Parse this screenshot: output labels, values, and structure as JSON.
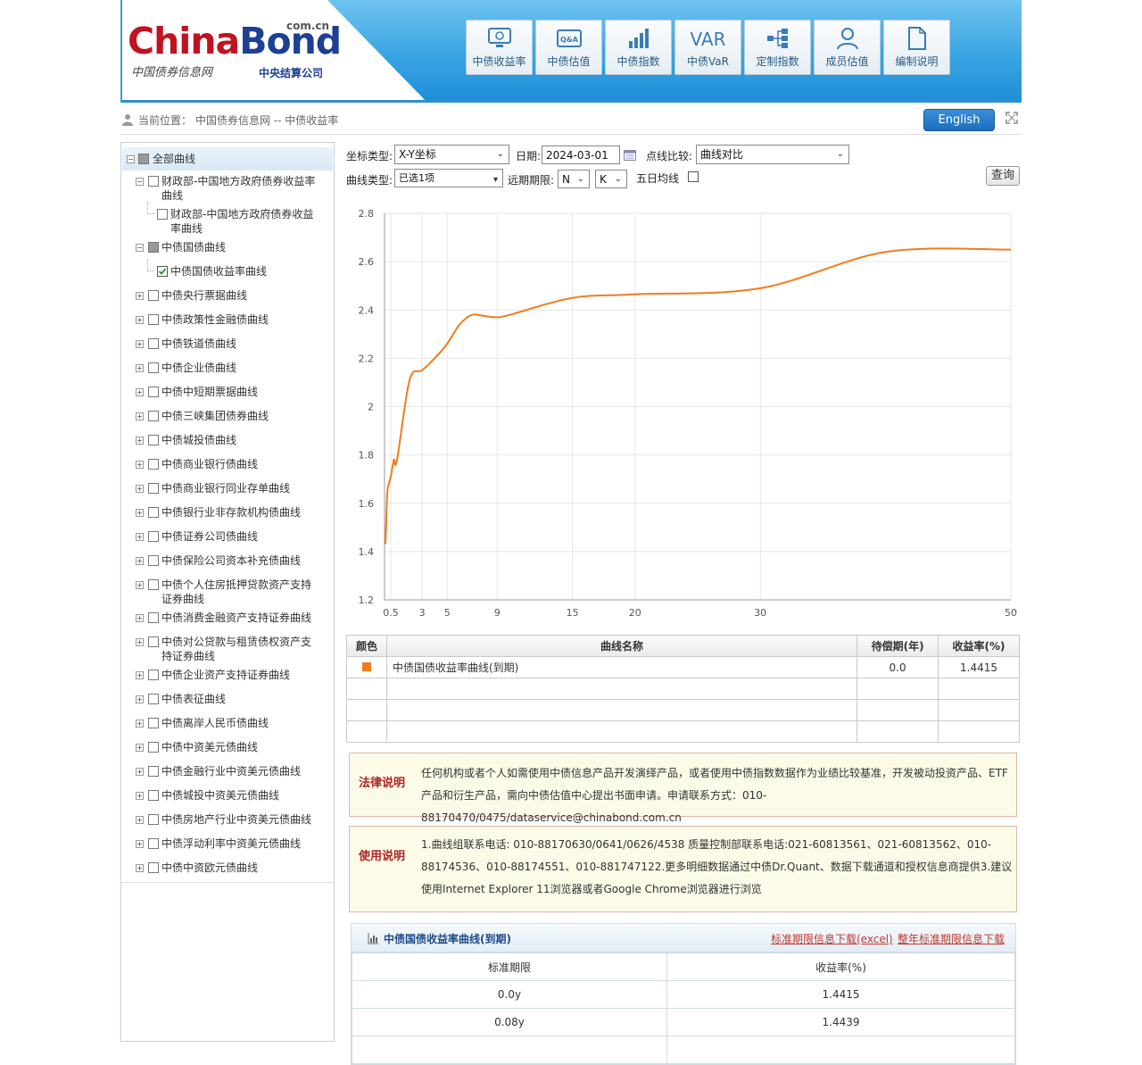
{
  "header": {
    "logo_main_a": "China",
    "logo_main_b": "Bond",
    "logo_domain": "com.cn",
    "logo_sub_left": "中国债券信息网",
    "logo_sub_right": "中央结算公司",
    "nav": [
      {
        "label": "中债收益率",
        "icon": "monitor-icon"
      },
      {
        "label": "中债估值",
        "icon": "qa-icon"
      },
      {
        "label": "中债指数",
        "icon": "bar-chart-icon"
      },
      {
        "label": "中债VaR",
        "icon": "var-icon",
        "icon_text": "VAR"
      },
      {
        "label": "定制指数",
        "icon": "tree-icon"
      },
      {
        "label": "成员估值",
        "icon": "user-icon"
      },
      {
        "label": "编制说明",
        "icon": "document-icon"
      }
    ]
  },
  "breadcrumb": {
    "prefix": "当前位置：",
    "path": "中国债券信息网 -- 中债收益率",
    "english_button": "English"
  },
  "sidebar": {
    "root_label": "全部曲线",
    "items": [
      {
        "label": "财政部-中国地方政府债券收益率曲线",
        "state": "minus"
      },
      {
        "label": "财政部-中国地方政府债券收益率曲线",
        "state": "child"
      },
      {
        "label": "中债国债曲线",
        "state": "minus"
      },
      {
        "label": "中债国债收益率曲线",
        "state": "child-checked"
      },
      {
        "label": "中债央行票据曲线",
        "state": "plus"
      },
      {
        "label": "中债政策性金融债曲线",
        "state": "plus"
      },
      {
        "label": "中债铁道债曲线",
        "state": "plus"
      },
      {
        "label": "中债企业债曲线",
        "state": "plus"
      },
      {
        "label": "中债中短期票据曲线",
        "state": "plus"
      },
      {
        "label": "中债三峡集团债券曲线",
        "state": "plus"
      },
      {
        "label": "中债城投债曲线",
        "state": "plus"
      },
      {
        "label": "中债商业银行债曲线",
        "state": "plus"
      },
      {
        "label": "中债商业银行同业存单曲线",
        "state": "plus"
      },
      {
        "label": "中债银行业非存款机构债曲线",
        "state": "plus"
      },
      {
        "label": "中债证券公司债曲线",
        "state": "plus"
      },
      {
        "label": "中债保险公司资本补充债曲线",
        "state": "plus"
      },
      {
        "label": "中债个人住房抵押贷款资产支持证券曲线",
        "state": "plus"
      },
      {
        "label": "中债消费金融资产支持证券曲线",
        "state": "plus"
      },
      {
        "label": "中债对公贷款与租赁债权资产支持证券曲线",
        "state": "plus"
      },
      {
        "label": "中债企业资产支持证券曲线",
        "state": "plus"
      },
      {
        "label": "中债表征曲线",
        "state": "plus"
      },
      {
        "label": "中债离岸人民币债曲线",
        "state": "plus"
      },
      {
        "label": "中债中资美元债曲线",
        "state": "plus"
      },
      {
        "label": "中债金融行业中资美元债曲线",
        "state": "plus"
      },
      {
        "label": "中债城投中资美元债曲线",
        "state": "plus"
      },
      {
        "label": "中债房地产行业中资美元债曲线",
        "state": "plus"
      },
      {
        "label": "中债浮动利率中资美元债曲线",
        "state": "plus"
      },
      {
        "label": "中债中资欧元债曲线",
        "state": "plus"
      }
    ]
  },
  "form": {
    "coord_label": "坐标类型:",
    "coord_value": "X-Y坐标",
    "date_label": "日期:",
    "date_value": "2024-03-01",
    "compare_label": "点线比较:",
    "compare_value": "曲线对比",
    "curve_type_label": "曲线类型:",
    "curve_type_value": "已选1项",
    "far_label": "远期期限:",
    "far_n": "N",
    "far_k": "K",
    "five_day_label": "五日均线",
    "query_button": "查询"
  },
  "chart_data": {
    "type": "line",
    "xlim": [
      0,
      50
    ],
    "ylim": [
      1.2,
      2.8
    ],
    "x_ticks": [
      "0.5",
      "3",
      "5",
      "9",
      "15",
      "20",
      "30",
      "50"
    ],
    "y_ticks": [
      "1.2",
      "1.4",
      "1.6",
      "1.8",
      "2",
      "2.2",
      "2.4",
      "2.6",
      "2.8"
    ],
    "grid": true,
    "color": "#f07c1e",
    "series": [
      {
        "x": [
          0,
          0.08,
          0.17,
          0.25,
          0.5,
          0.75,
          1,
          2,
          3,
          4,
          5,
          6,
          7,
          8,
          9,
          10,
          15,
          20,
          30,
          40,
          50
        ],
        "values": [
          1.4415,
          1.4439,
          1.58,
          1.66,
          1.71,
          1.78,
          1.78,
          2.11,
          2.15,
          2.2,
          2.26,
          2.34,
          2.38,
          2.375,
          2.37,
          2.38,
          2.45,
          2.465,
          2.49,
          2.64,
          2.65
        ]
      }
    ]
  },
  "result_table": {
    "headers": [
      "颜色",
      "曲线名称",
      "待偿期(年)",
      "收益率(%)"
    ],
    "rows": [
      {
        "color": "#f07c1e",
        "name": "中债国债收益率曲线(到期)",
        "term": "0.0",
        "yield": "1.4415"
      }
    ]
  },
  "legal": {
    "title": "法律说明",
    "text": "任何机构或者个人如需使用中债信息产品开发演绎产品，或者使用中债指数数据作为业绩比较基准，开发被动投资产品、ETF产品和衍生产品，需向中债估值中心提出书面申请。申请联系方式：010-88170470/0475/dataservice@chinabond.com.cn"
  },
  "usage": {
    "title": "使用说明",
    "text": "1.曲线组联系电话: 010-88170630/0641/0626/4538  质量控制部联系电话:021-60813561、021-60813562、010-88174536、010-88174551、010-881747122.更多明细数据通过中债Dr.Quant、数据下载通道和授权信息商提供3.建议使用Internet Explorer 11浏览器或者Google Chrome浏览器进行浏览"
  },
  "download": {
    "title": "中债国债收益率曲线(到期)",
    "link1": "标准期限信息下载(excel)",
    "link2": "整年标准期限信息下载",
    "headers": [
      "标准期限",
      "收益率(%)"
    ],
    "rows": [
      {
        "term": "0.0y",
        "yield": "1.4415"
      },
      {
        "term": "0.08y",
        "yield": "1.4439"
      }
    ]
  }
}
